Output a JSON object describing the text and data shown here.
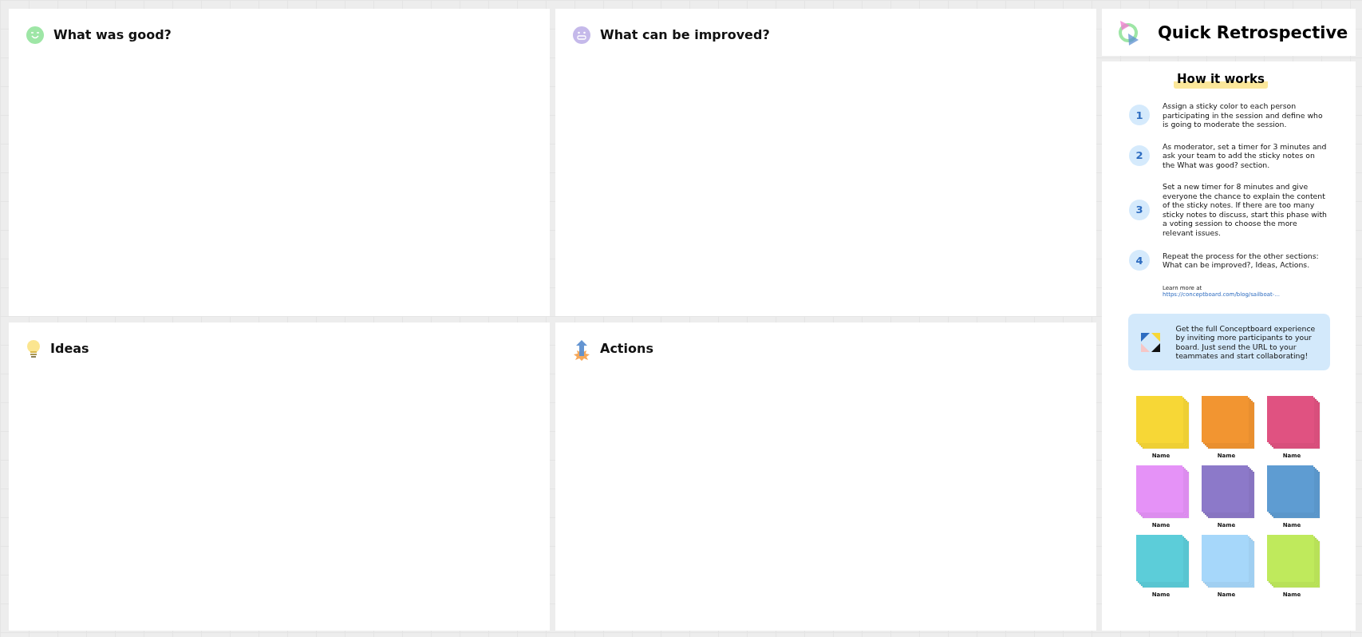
{
  "sections": [
    {
      "kind": "good",
      "title": "What was good?"
    },
    {
      "kind": "improve",
      "title": "What can be improved?"
    },
    {
      "kind": "ideas",
      "title": "Ideas"
    },
    {
      "kind": "actions",
      "title": "Actions"
    }
  ],
  "board_title": "Quick Retrospective",
  "how_it_works": {
    "heading": "How it works",
    "steps": [
      {
        "number": "1",
        "text": "Assign a sticky color to each person participating in the session and define who is going to moderate the session."
      },
      {
        "number": "2",
        "text": "As moderator, set a timer for 3 minutes and ask your team to add the sticky notes on the What was good? section."
      },
      {
        "number": "3",
        "text": "Set a new timer for 8 minutes and give everyone the chance to explain the content of the sticky notes. If there are too many sticky notes to discuss, start this phase with a voting session to choose the more relevant issues."
      },
      {
        "number": "4",
        "text": "Repeat the process for the other sections: What can be improved?, Ideas, Actions."
      }
    ],
    "learn_more": "Learn more at",
    "link": "https://conceptboard.com/blog/sailboat-..."
  },
  "invite_banner": "Get the full Conceptboard experience by inviting more participants to your board. Just send the URL to your teammates and start collaborating!",
  "stickies": [
    {
      "label": "Name",
      "color": "#f7d736"
    },
    {
      "label": "Name",
      "color": "#f29531"
    },
    {
      "label": "Name",
      "color": "#e05281"
    },
    {
      "label": "Name",
      "color": "#e592f7"
    },
    {
      "label": "Name",
      "color": "#8c79c9"
    },
    {
      "label": "Name",
      "color": "#5e9cd2"
    },
    {
      "label": "Name",
      "color": "#5ccdd9"
    },
    {
      "label": "Name",
      "color": "#a6d7fa"
    },
    {
      "label": "Name",
      "color": "#bfea5c"
    }
  ]
}
